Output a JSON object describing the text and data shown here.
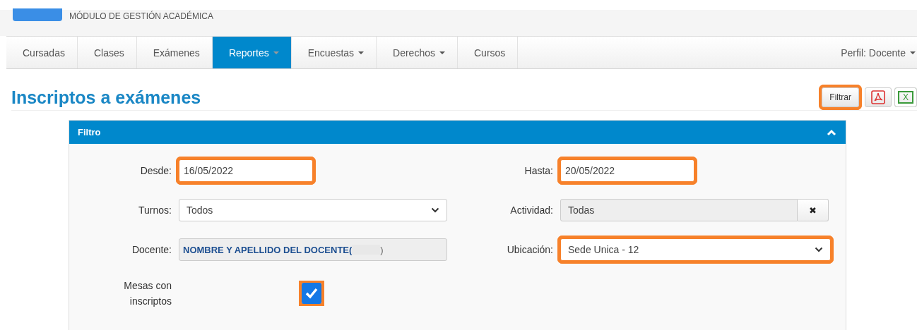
{
  "header": {
    "subtitle": "MÓDULO DE GESTIÓN ACADÉMICA"
  },
  "nav": {
    "tabs": [
      {
        "label": "Cursadas",
        "selected": false,
        "dropdown": false
      },
      {
        "label": "Clases",
        "selected": false,
        "dropdown": false
      },
      {
        "label": "Exámenes",
        "selected": false,
        "dropdown": false
      },
      {
        "label": "Reportes",
        "selected": true,
        "dropdown": true
      },
      {
        "label": "Encuestas",
        "selected": false,
        "dropdown": true
      },
      {
        "label": "Derechos",
        "selected": false,
        "dropdown": true
      },
      {
        "label": "Cursos",
        "selected": false,
        "dropdown": false
      }
    ],
    "profile": "Perfil: Docente"
  },
  "page": {
    "title": "Inscriptos a exámenes",
    "filter_button": {
      "label": "Filtrar",
      "highlighted": true
    },
    "export_buttons": [
      {
        "kind": "pdf"
      },
      {
        "kind": "excel",
        "label": "X"
      }
    ]
  },
  "filter": {
    "title": "Filtro",
    "expanded": true,
    "fields": [
      {
        "kind": "date",
        "label": "Desde:",
        "value": "16/05/2022",
        "highlighted": true
      },
      {
        "kind": "date",
        "label": "Hasta:",
        "value": "20/05/2022",
        "highlighted": true
      },
      {
        "kind": "select",
        "label": "Turnos:",
        "value": "Todos",
        "highlighted": false
      },
      {
        "kind": "lookup",
        "label": "Actividad:",
        "value": "Todas",
        "clear": "✖",
        "highlighted": false
      },
      {
        "kind": "readonly",
        "label": "Docente:",
        "value": "NOMBRE Y APELLIDO DEL DOCENTE(",
        "suffix": ")",
        "highlighted": false
      },
      {
        "kind": "select",
        "label": "Ubicación:",
        "value": "Sede Unica - 12",
        "highlighted": true
      },
      {
        "kind": "checkbox",
        "label": "Mesas con inscriptos",
        "checked": true,
        "highlighted": true
      }
    ]
  }
}
